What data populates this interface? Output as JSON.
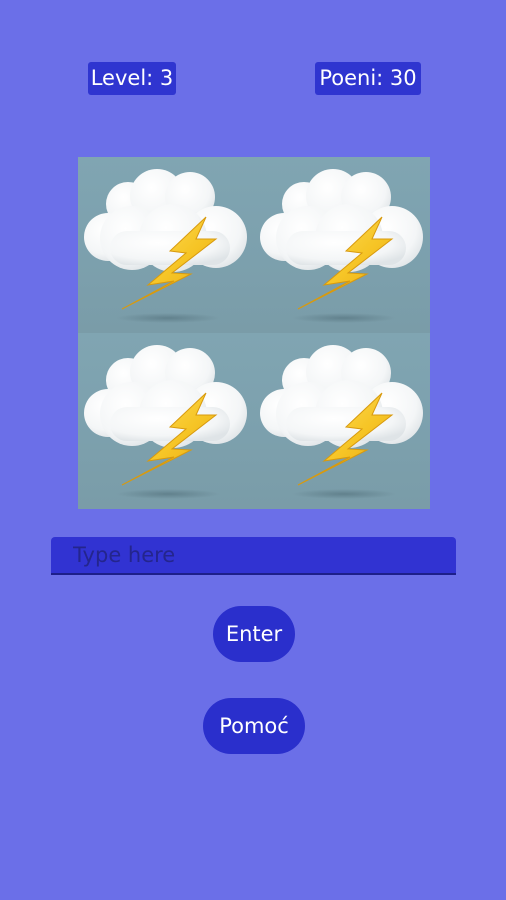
{
  "header": {
    "level_label": "Level: 3",
    "points_label": "Poeni: 30"
  },
  "puzzle": {
    "images": [
      "thunderstorm-cloud-icon",
      "thunderstorm-cloud-icon",
      "thunderstorm-cloud-icon",
      "thunderstorm-cloud-icon"
    ]
  },
  "answer": {
    "placeholder": "Type here",
    "value": ""
  },
  "buttons": {
    "enter_label": "Enter",
    "help_label": "Pomoć"
  },
  "colors": {
    "background": "#6b6fe8",
    "accent": "#2f35d0",
    "tile_bg": "#7ea3b0",
    "bolt": "#f6c526"
  }
}
